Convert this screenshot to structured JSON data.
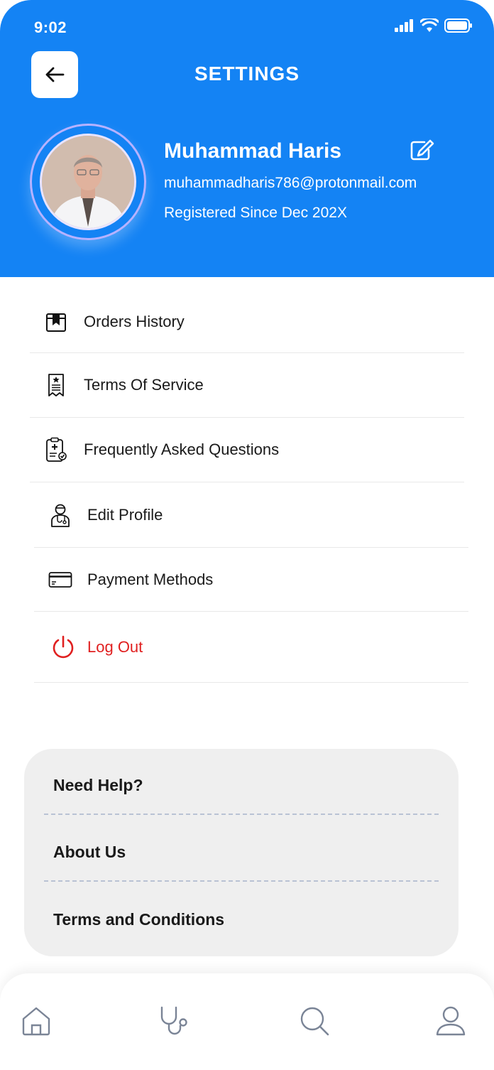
{
  "status_bar": {
    "time": "9:02"
  },
  "header": {
    "title": "SETTINGS",
    "back_icon": "arrow-left-icon"
  },
  "profile": {
    "name": "Muhammad Haris",
    "email": "muhammadharis786@protonmail.com",
    "registered": "Registered Since Dec 202X"
  },
  "menu": [
    {
      "label": "Orders History",
      "icon": "box-icon"
    },
    {
      "label": "Terms Of Service",
      "icon": "document-icon"
    },
    {
      "label": "Frequently Asked Questions",
      "icon": "clipboard-check-icon"
    },
    {
      "label": "Edit Profile",
      "icon": "doctor-icon"
    },
    {
      "label": "Payment Methods",
      "icon": "credit-card-icon"
    },
    {
      "label": "Log Out",
      "icon": "power-icon"
    }
  ],
  "help": {
    "items": [
      "Need Help?",
      "About Us",
      "Terms and Conditions"
    ]
  },
  "nav": [
    "home-icon",
    "stethoscope-icon",
    "search-icon",
    "user-icon"
  ],
  "colors": {
    "primary": "#1483f4",
    "danger": "#e02020",
    "card": "#efefef"
  }
}
